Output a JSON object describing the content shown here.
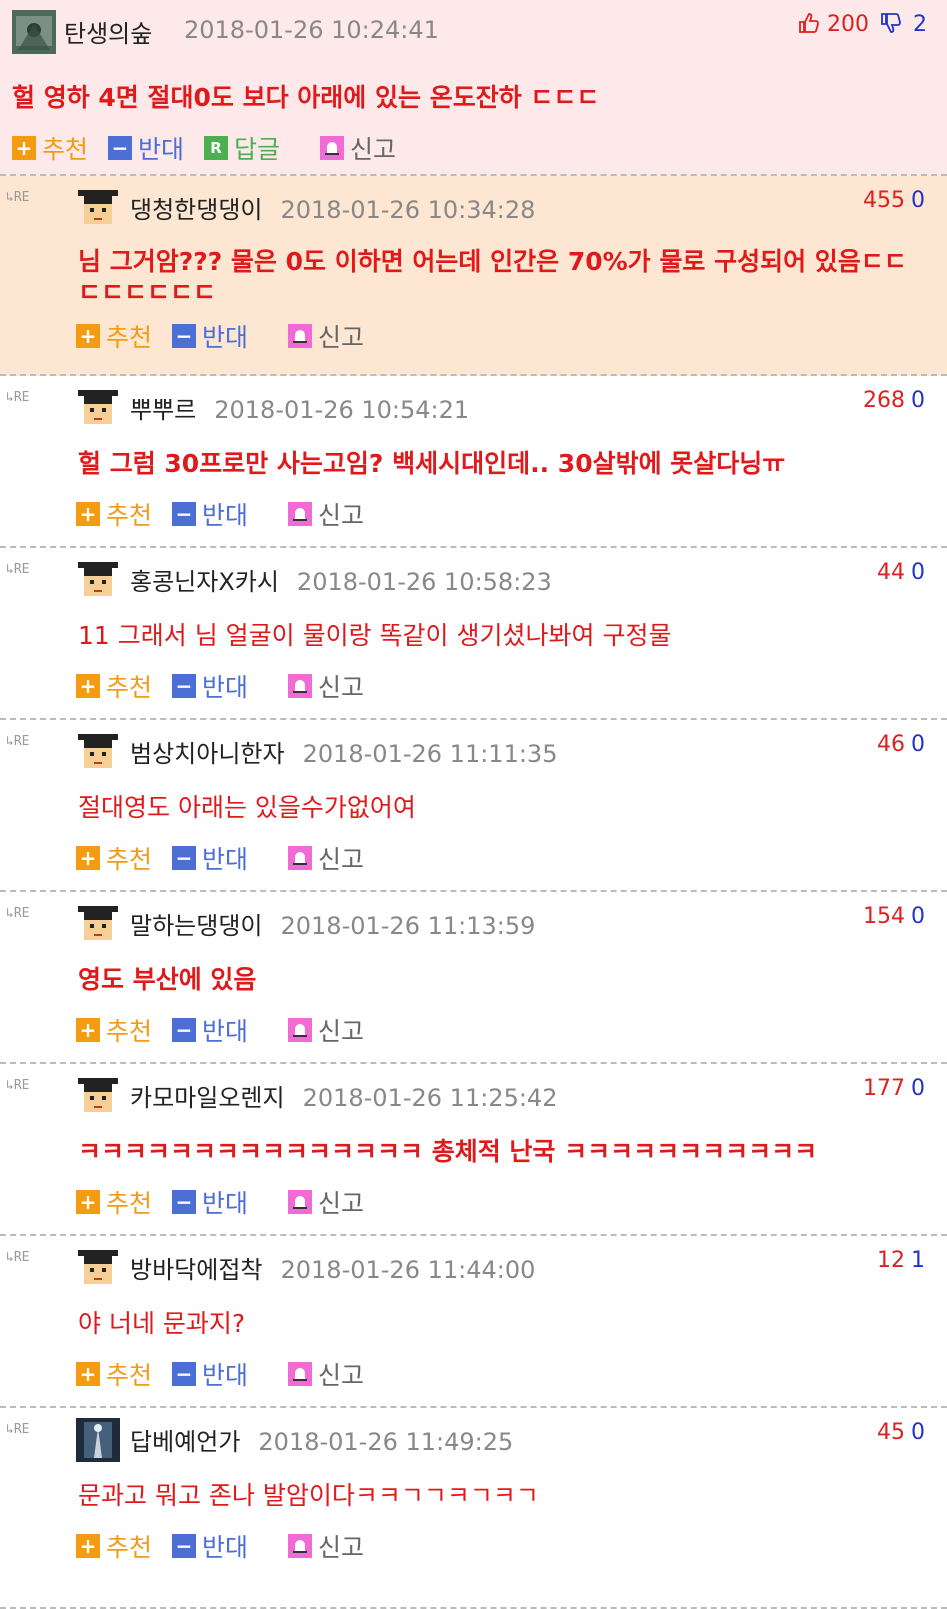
{
  "post": {
    "nick": "탄생의숲",
    "time": "2018-01-26 10:24:41",
    "upvotes": "200",
    "downvotes": "2",
    "body": "헐 영하 4면 절대0도 보다 아래에 있는 온도잔하 ㄷㄷㄷ",
    "actions": {
      "recommend": "추천",
      "oppose": "반대",
      "reply": "답글",
      "report": "신고"
    }
  },
  "re_label": "RE",
  "comment_actions": {
    "recommend": "추천",
    "oppose": "반대",
    "report": "신고"
  },
  "comments": [
    {
      "nick": "댕청한댕댕이",
      "time": "2018-01-26 10:34:28",
      "up": "455",
      "down": "0",
      "body": "님 그거암??? 물은 0도 이하면 어는데 인간은 70%가 물로 구성되어 있음ㄷㄷ ㄷㄷㄷㄷㄷㄷ"
    },
    {
      "nick": "뿌뿌르",
      "time": "2018-01-26 10:54:21",
      "up": "268",
      "down": "0",
      "body": "헐 그럼 30프로만 사는고임? 백세시대인데.. 30살밖에 못살다닝ㅠ"
    },
    {
      "nick": "홍콩닌자X카시",
      "time": "2018-01-26 10:58:23",
      "up": "44",
      "down": "0",
      "body": "11 그래서 님 얼굴이 물이랑 똑같이 생기셨나봐여 구정물"
    },
    {
      "nick": "범상치아니한자",
      "time": "2018-01-26 11:11:35",
      "up": "46",
      "down": "0",
      "body": "절대영도 아래는 있을수가없어여"
    },
    {
      "nick": "말하는댕댕이",
      "time": "2018-01-26 11:13:59",
      "up": "154",
      "down": "0",
      "body": "영도 부산에 있음"
    },
    {
      "nick": "카모마일오렌지",
      "time": "2018-01-26 11:25:42",
      "up": "177",
      "down": "0",
      "body": "ㅋㅋㅋㅋㅋㅋㅋㅋㅋㅋㅋㅋㅋㅋㅋ 총체적 난국 ㅋㅋㅋㅋㅋㅋㅋㅋㅋㅋㅋ"
    },
    {
      "nick": "방바닥에접착",
      "time": "2018-01-26 11:44:00",
      "up": "12",
      "down": "1",
      "body": "야 너네 문과지?"
    },
    {
      "nick": "답베예언가",
      "time": "2018-01-26 11:49:25",
      "up": "45",
      "down": "0",
      "body": "문과고 뭐고 존나 발암이다ㅋㅋㄱㄱㅋㄱㅋㄱ"
    }
  ],
  "colors": {
    "post_bg": "#fde9e9",
    "highlight_bg": "#fde6d2",
    "text_red": "#e0191b",
    "recommend": "#f39c12",
    "oppose": "#4b6fd4",
    "reply": "#4caf50",
    "report": "#f06bd3"
  }
}
